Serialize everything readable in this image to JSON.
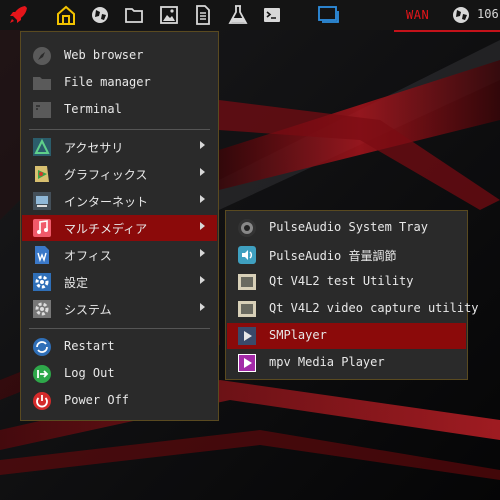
{
  "topbar": {
    "icons": [
      "rocket-icon",
      "home-icon",
      "globe-icon",
      "folder-icon",
      "image-icon",
      "document-icon",
      "flask-icon",
      "terminal-icon",
      "window-icon"
    ],
    "network_label": "WAN",
    "network_value": "106"
  },
  "menu": {
    "quick": [
      {
        "label": "Web browser",
        "icon": "compass-icon"
      },
      {
        "label": "File manager",
        "icon": "folder-icon"
      },
      {
        "label": "Terminal",
        "icon": "terminal-icon"
      }
    ],
    "categories": [
      {
        "label": "アクセサリ",
        "icon": "accessories-icon"
      },
      {
        "label": "グラフィックス",
        "icon": "graphics-icon"
      },
      {
        "label": "インターネット",
        "icon": "network-icon"
      },
      {
        "label": "マルチメディア",
        "icon": "music-icon",
        "selected": true
      },
      {
        "label": "オフィス",
        "icon": "office-icon"
      },
      {
        "label": "設定",
        "icon": "settings-icon"
      },
      {
        "label": "システム",
        "icon": "system-icon"
      }
    ],
    "session": [
      {
        "label": "Restart",
        "icon": "restart-icon"
      },
      {
        "label": "Log Out",
        "icon": "logout-icon"
      },
      {
        "label": "Power Off",
        "icon": "power-icon"
      }
    ]
  },
  "submenu": {
    "items": [
      {
        "label": "PulseAudio System Tray",
        "icon": "speaker-icon"
      },
      {
        "label": "PulseAudio 音量調節",
        "icon": "volume-icon"
      },
      {
        "label": "Qt V4L2 test Utility",
        "icon": "qt-icon"
      },
      {
        "label": "Qt V4L2 video capture utility",
        "icon": "qt-icon"
      },
      {
        "label": "SMPlayer",
        "icon": "smplayer-icon",
        "selected": true
      },
      {
        "label": "mpv Media Player",
        "icon": "mpv-icon"
      }
    ]
  },
  "colors": {
    "accent": "#e5151a",
    "selection": "#8b0a0a",
    "menu_bg": "#2a2a2a",
    "home": "#f2c200"
  }
}
